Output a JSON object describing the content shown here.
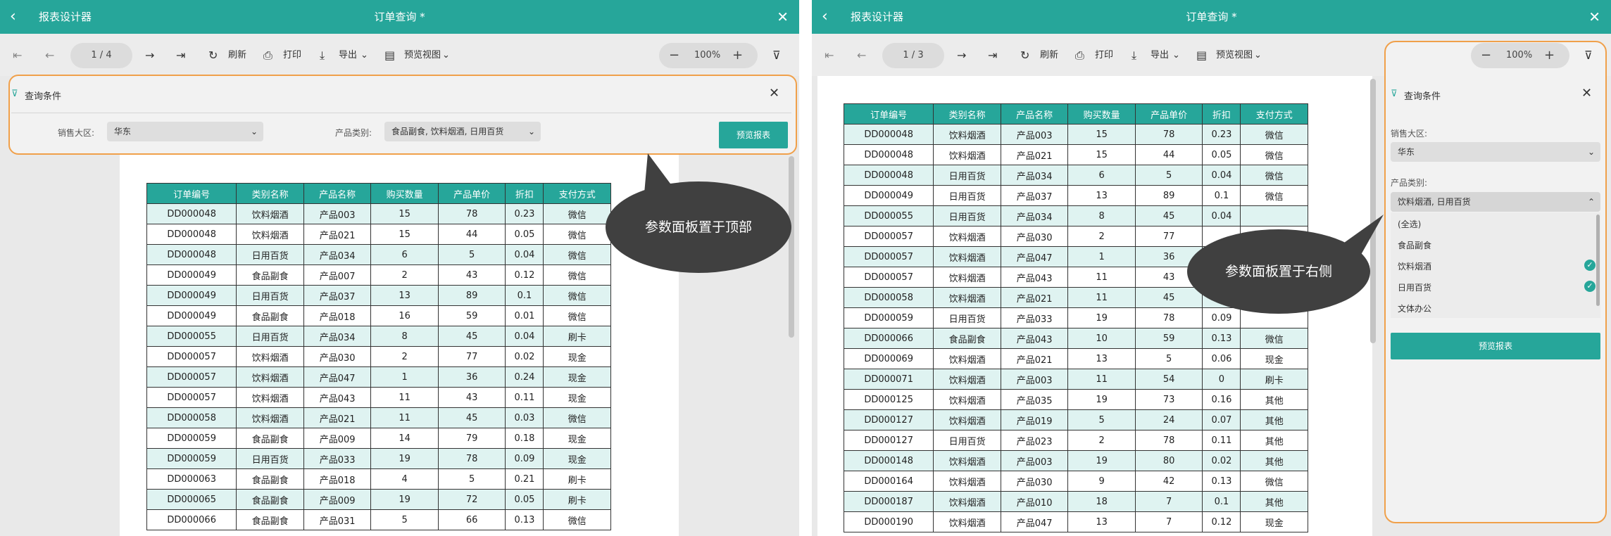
{
  "header": {
    "back_glyph": "‹",
    "app_title": "报表设计器",
    "doc_title": "订单查询 *",
    "close_glyph": "✕"
  },
  "toolbar": {
    "first_glyph": "⇤",
    "prev_glyph": "←",
    "next_glyph": "→",
    "last_glyph": "⇥",
    "refresh_icon": "↻",
    "refresh": "刷新",
    "print_icon": "⎙",
    "print": "打印",
    "export_icon": "⤓",
    "export": "导出",
    "preview_icon": "▤",
    "preview": "预览视图",
    "dropdown_glyph": "⌄",
    "zoom_out": "−",
    "zoom": "100%",
    "zoom_in": "+",
    "filter_icon": "⊽"
  },
  "left": {
    "page": "1 / 4"
  },
  "right": {
    "page": "1 / 3"
  },
  "columns": [
    "订单编号",
    "类别名称",
    "产品名称",
    "购买数量",
    "产品单价",
    "折扣",
    "支付方式"
  ],
  "left_rows": [
    [
      "DD000048",
      "饮料烟酒",
      "产品003",
      "15",
      "78",
      "0.23",
      "微信"
    ],
    [
      "DD000048",
      "饮料烟酒",
      "产品021",
      "15",
      "44",
      "0.05",
      "微信"
    ],
    [
      "DD000048",
      "日用百货",
      "产品034",
      "6",
      "5",
      "0.04",
      "微信"
    ],
    [
      "DD000049",
      "食品副食",
      "产品007",
      "2",
      "43",
      "0.12",
      "微信"
    ],
    [
      "DD000049",
      "日用百货",
      "产品037",
      "13",
      "89",
      "0.1",
      "微信"
    ],
    [
      "DD000049",
      "食品副食",
      "产品018",
      "16",
      "59",
      "0.01",
      "微信"
    ],
    [
      "DD000055",
      "日用百货",
      "产品034",
      "8",
      "45",
      "0.04",
      "刷卡"
    ],
    [
      "DD000057",
      "饮料烟酒",
      "产品030",
      "2",
      "77",
      "0.02",
      "现金"
    ],
    [
      "DD000057",
      "饮料烟酒",
      "产品047",
      "1",
      "36",
      "0.24",
      "现金"
    ],
    [
      "DD000057",
      "饮料烟酒",
      "产品043",
      "11",
      "43",
      "0.11",
      "现金"
    ],
    [
      "DD000058",
      "饮料烟酒",
      "产品021",
      "11",
      "45",
      "0.03",
      "微信"
    ],
    [
      "DD000059",
      "食品副食",
      "产品009",
      "14",
      "79",
      "0.18",
      "现金"
    ],
    [
      "DD000059",
      "日用百货",
      "产品033",
      "19",
      "78",
      "0.09",
      "现金"
    ],
    [
      "DD000063",
      "食品副食",
      "产品018",
      "4",
      "5",
      "0.21",
      "刷卡"
    ],
    [
      "DD000065",
      "食品副食",
      "产品009",
      "19",
      "72",
      "0.05",
      "刷卡"
    ],
    [
      "DD000066",
      "食品副食",
      "产品031",
      "5",
      "66",
      "0.13",
      "微信"
    ]
  ],
  "right_rows": [
    [
      "DD000048",
      "饮料烟酒",
      "产品003",
      "15",
      "78",
      "0.23",
      "微信"
    ],
    [
      "DD000048",
      "饮料烟酒",
      "产品021",
      "15",
      "44",
      "0.05",
      "微信"
    ],
    [
      "DD000048",
      "日用百货",
      "产品034",
      "6",
      "5",
      "0.04",
      "微信"
    ],
    [
      "DD000049",
      "日用百货",
      "产品037",
      "13",
      "89",
      "0.1",
      "微信"
    ],
    [
      "DD000055",
      "日用百货",
      "产品034",
      "8",
      "45",
      "0.04",
      ""
    ],
    [
      "DD000057",
      "饮料烟酒",
      "产品030",
      "2",
      "77",
      "",
      ""
    ],
    [
      "DD000057",
      "饮料烟酒",
      "产品047",
      "1",
      "36",
      "",
      ""
    ],
    [
      "DD000057",
      "饮料烟酒",
      "产品043",
      "11",
      "43",
      "",
      ""
    ],
    [
      "DD000058",
      "饮料烟酒",
      "产品021",
      "11",
      "45",
      "",
      ""
    ],
    [
      "DD000059",
      "日用百货",
      "产品033",
      "19",
      "78",
      "0.09",
      ""
    ],
    [
      "DD000066",
      "食品副食",
      "产品043",
      "10",
      "59",
      "0.13",
      "微信"
    ],
    [
      "DD000069",
      "饮料烟酒",
      "产品021",
      "13",
      "5",
      "0.06",
      "现金"
    ],
    [
      "DD000071",
      "饮料烟酒",
      "产品003",
      "11",
      "54",
      "0",
      "刷卡"
    ],
    [
      "DD000125",
      "饮料烟酒",
      "产品035",
      "19",
      "73",
      "0.16",
      "其他"
    ],
    [
      "DD000127",
      "饮料烟酒",
      "产品019",
      "5",
      "24",
      "0.07",
      "其他"
    ],
    [
      "DD000127",
      "日用百货",
      "产品023",
      "2",
      "78",
      "0.11",
      "其他"
    ],
    [
      "DD000148",
      "饮料烟酒",
      "产品003",
      "19",
      "80",
      "0.02",
      "其他"
    ],
    [
      "DD000164",
      "饮料烟酒",
      "产品030",
      "9",
      "42",
      "0.13",
      "微信"
    ],
    [
      "DD000187",
      "饮料烟酒",
      "产品010",
      "18",
      "7",
      "0.1",
      "其他"
    ],
    [
      "DD000190",
      "饮料烟酒",
      "产品047",
      "13",
      "7",
      "0.12",
      "现金"
    ]
  ],
  "params": {
    "title": "查询条件",
    "filter_icon": "⊽",
    "close_glyph": "✕",
    "region_label": "销售大区:",
    "region_value": "华东",
    "category_label": "产品类别:",
    "category_value": "食品副食, 饮料烟酒, 日用百货",
    "category_value_right": "饮料烟酒, 日用百货",
    "chevron_down": "⌄",
    "chevron_up": "⌃",
    "preview_button": "预览报表",
    "options": [
      "(全选)",
      "食品副食",
      "饮料烟酒",
      "日用百货",
      "文体办公"
    ],
    "check_glyph": "✓"
  },
  "callouts": {
    "top": "参数面板置于顶部",
    "right": "参数面板置于右侧"
  },
  "colors": {
    "accent": "#26a69a",
    "highlight": "#f0a04a",
    "row_tint": "#dff3f1",
    "bubble": "#404040"
  }
}
